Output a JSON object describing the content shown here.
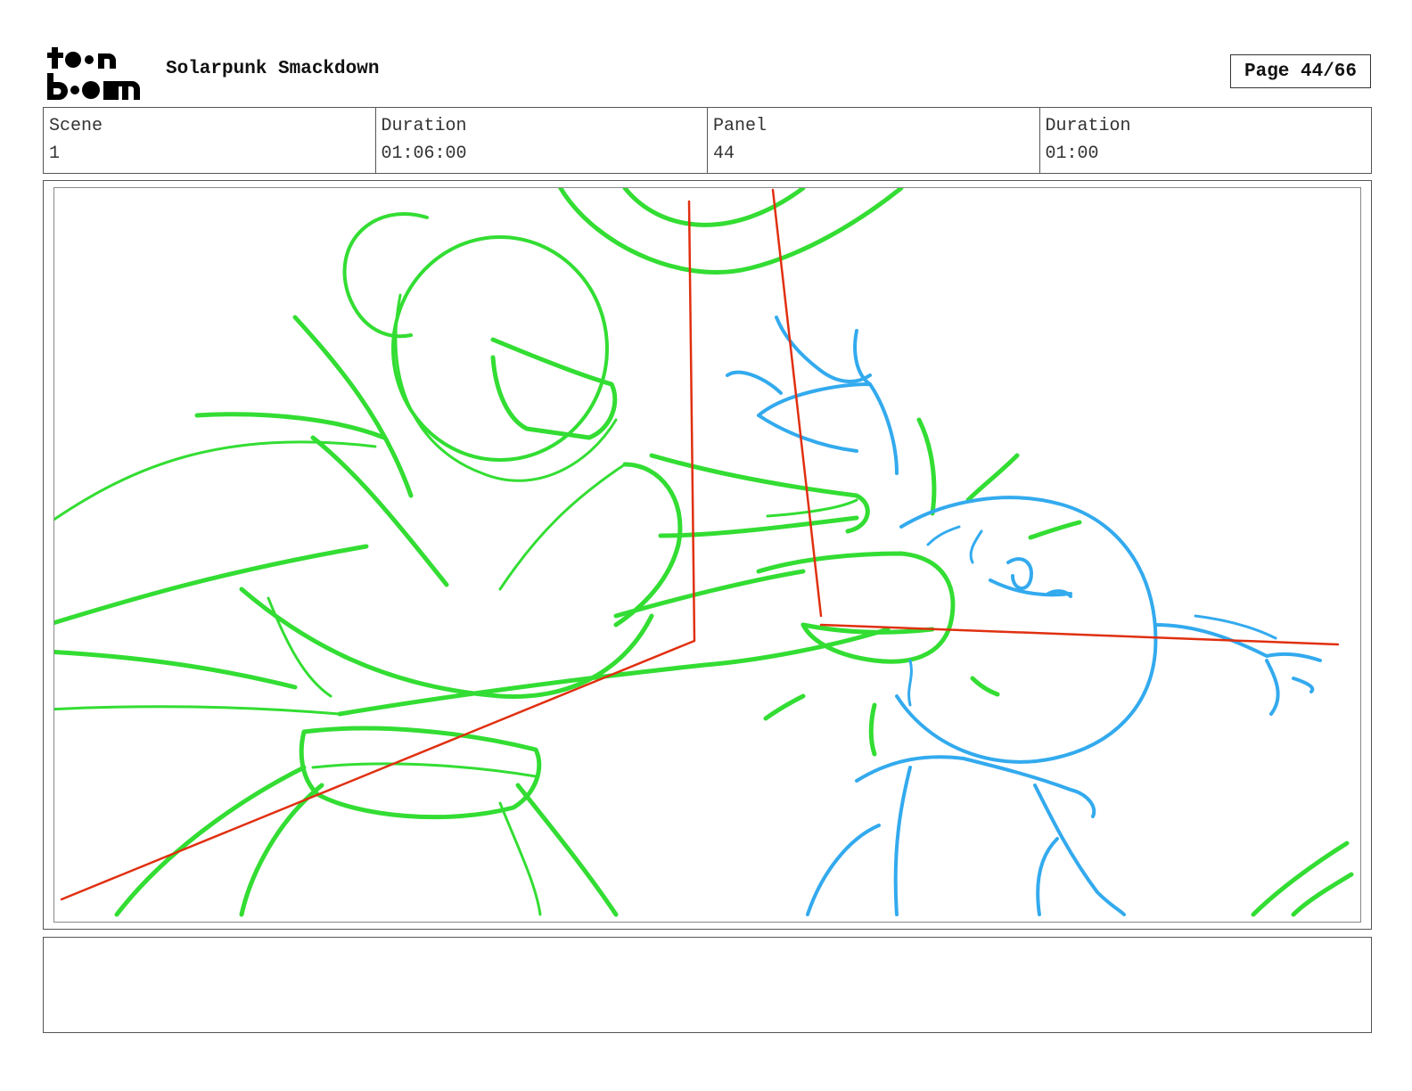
{
  "header": {
    "logo_text": "toon boom",
    "project_title": "Solarpunk Smackdown",
    "page_label": "Page 44/66"
  },
  "info": [
    {
      "label": "Scene",
      "value": "1"
    },
    {
      "label": "Duration",
      "value": "01:06:00"
    },
    {
      "label": "Panel",
      "value": "44"
    },
    {
      "label": "Duration",
      "value": "01:00"
    }
  ],
  "panel": {
    "stroke_colors": {
      "left_character": "#33dd33",
      "right_character": "#33aaee",
      "guides": "#e03010"
    }
  },
  "notes": {
    "text": ""
  }
}
